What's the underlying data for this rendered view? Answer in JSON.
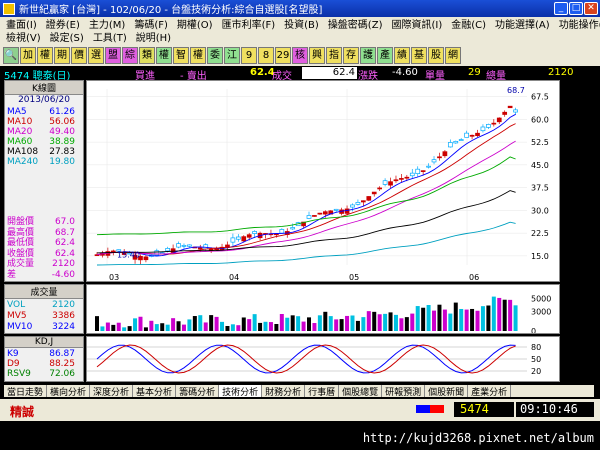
{
  "window": {
    "title": "新世紀贏家 [台灣] - 102/06/20 - 台盤技術分析:綜合自選股[名望股]"
  },
  "menu": {
    "row1": [
      "畫面(I)",
      "證券(E)",
      "主力(M)",
      "籌碼(F)",
      "期權(O)",
      "匯市利率(F)",
      "投資(B)",
      "操盤密碼(Z)",
      "國際資訊(I)",
      "金融(C)",
      "功能選擇(A)",
      "功能操作(F)"
    ],
    "row2": [
      "檢視(V)",
      "設定(S)",
      "工具(T)",
      "說明(H)"
    ]
  },
  "toolbar": {
    "buttons": [
      "加",
      "權",
      "期",
      "價",
      "選",
      "盟",
      "綜",
      "類",
      "權",
      "智",
      "權",
      "委",
      "江",
      "9",
      "8",
      "29",
      "核",
      "興",
      "指",
      "存",
      "護",
      "產",
      "績",
      "基",
      "股",
      "網"
    ]
  },
  "quote": {
    "code_name": "5474 聰泰(日)",
    "buy_label": "買進",
    "sell_label": "- 賣出",
    "last": "62.4",
    "trade_label": "成交",
    "trade_value": "62.4",
    "change_label": "漲跌",
    "change": "-4.60",
    "vol_label": "單量",
    "single_volume": "29",
    "total_label": "總量",
    "total_volume": "2120"
  },
  "kpanel": {
    "title": "K線圖",
    "date": "2013/06/20",
    "ma": [
      {
        "name": "MA5",
        "value": "61.26",
        "color": "#0000ff"
      },
      {
        "name": "MA10",
        "value": "56.06",
        "color": "#cc0000"
      },
      {
        "name": "MA20",
        "value": "49.40",
        "color": "#cc00cc"
      },
      {
        "name": "MA60",
        "value": "38.89",
        "color": "#00aa00"
      },
      {
        "name": "MA108",
        "value": "27.83",
        "color": "#000000"
      },
      {
        "name": "MA240",
        "value": "19.80",
        "color": "#00a0c0"
      }
    ],
    "prices": [
      {
        "name": "開盤價",
        "value": "67.0"
      },
      {
        "name": "最高價",
        "value": "68.7"
      },
      {
        "name": "最低價",
        "value": "62.4"
      },
      {
        "name": "收盤價",
        "value": "62.4"
      },
      {
        "name": "成交量",
        "value": "2120"
      },
      {
        "name": "差",
        "value": "-4.60"
      }
    ],
    "high_label": "68.7",
    "low_label": "15.40"
  },
  "volpanel": {
    "title": "成交量",
    "rows": [
      {
        "name": "VOL",
        "value": "2120",
        "color": "#00a0c0"
      },
      {
        "name": "MV5",
        "value": "3386",
        "color": "#cc0000"
      },
      {
        "name": "MV10",
        "value": "3224",
        "color": "#0000ff"
      }
    ]
  },
  "kdpanel": {
    "title": "KD,J",
    "rows": [
      {
        "name": "K9",
        "value": "86.87",
        "color": "#0000ff"
      },
      {
        "name": "D9",
        "value": "88.25",
        "color": "#cc0000"
      },
      {
        "name": "RSV9",
        "value": "72.06",
        "color": "#008000"
      }
    ]
  },
  "chart_data": [
    {
      "type": "candlestick",
      "title": "K線圖",
      "x_ticks": [
        "03",
        "04",
        "05",
        "06"
      ],
      "y_ticks": [
        "67.5",
        "60.0",
        "52.5",
        "45.0",
        "37.5",
        "30.0",
        "22.5",
        "15.0"
      ],
      "ylim": [
        12,
        70
      ],
      "annotations": [
        "68.7",
        "15.40"
      ]
    },
    {
      "type": "bar",
      "title": "成交量",
      "y_ticks": [
        "5000",
        "3000",
        "0"
      ],
      "ylim": [
        0,
        6500
      ]
    },
    {
      "type": "line",
      "title": "KD,J",
      "y_ticks": [
        "80",
        "50",
        "20"
      ],
      "ylim": [
        0,
        100
      ]
    }
  ],
  "tabs": [
    "當日走勢",
    "橫向分析",
    "深度分析",
    "基本分析",
    "籌碼分析",
    "技術分析",
    "財務分析",
    "行事曆",
    "個股總覽",
    "研報預測",
    "個股新聞",
    "產業分析"
  ],
  "selected_tab": "技術分析",
  "status": {
    "left": "精誠",
    "code": "5474",
    "time": "09:10:46"
  },
  "footer": {
    "url": "http://kujd3268.pixnet.net/album"
  },
  "colors": {
    "up": "#cc0000",
    "down": "#009900",
    "accent": "#1a4fd6"
  }
}
